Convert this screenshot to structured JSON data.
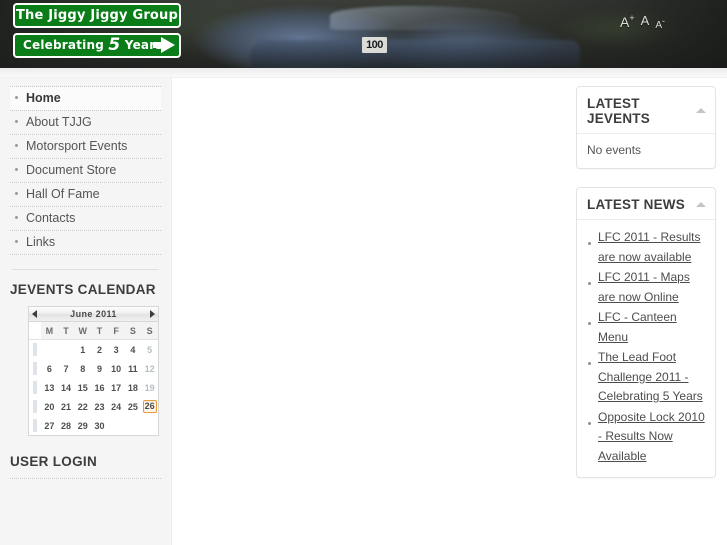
{
  "site": {
    "logo_line1": "The Jiggy Jiggy Group",
    "logo_line2_pre": "Celebrating ",
    "logo_line2_number": "5",
    "logo_line2_post": " Years"
  },
  "header": {
    "car_number": "100",
    "font_size": {
      "increase": "A",
      "increase_sup": "+",
      "reset": "A",
      "decrease": "A",
      "decrease_sup": "-"
    }
  },
  "sidebar_left": {
    "menu": [
      {
        "label": "Home",
        "active": true
      },
      {
        "label": "About TJJG",
        "active": false
      },
      {
        "label": "Motorsport Events",
        "active": false
      },
      {
        "label": "Document Store",
        "active": false
      },
      {
        "label": "Hall Of Fame",
        "active": false
      },
      {
        "label": "Contacts",
        "active": false
      },
      {
        "label": "Links",
        "active": false
      }
    ],
    "calendar_module_title": "JEVENTS CALENDAR",
    "user_login_title": "USER LOGIN"
  },
  "calendar": {
    "title": "June 2011",
    "prev_label": "Previous month",
    "next_label": "Next month",
    "weekday_headers": [
      "M",
      "T",
      "W",
      "T",
      "F",
      "S",
      "S"
    ],
    "weeks": [
      [
        "",
        "",
        "1",
        "2",
        "3",
        "4",
        "5"
      ],
      [
        "6",
        "7",
        "8",
        "9",
        "10",
        "11",
        "12"
      ],
      [
        "13",
        "14",
        "15",
        "16",
        "17",
        "18",
        "19"
      ],
      [
        "20",
        "21",
        "22",
        "23",
        "24",
        "25",
        "26"
      ],
      [
        "27",
        "28",
        "29",
        "30",
        "",
        "",
        ""
      ]
    ],
    "today": "26",
    "today_border_color": "#e89a3c"
  },
  "sidebar_right": {
    "jevents_panel": {
      "title": "LATEST JEVENTS",
      "body_text": "No events"
    },
    "news_panel": {
      "title": "LATEST NEWS",
      "items": [
        "LFC 2011 - Results are now available",
        "LFC 2011 - Maps are now Online",
        "LFC - Canteen Menu",
        "The Lead Foot Challenge 2011 - Celebrating 5 Years",
        "Opposite Lock 2010 - Results Now Available"
      ]
    }
  },
  "colors": {
    "brand_green": "#0a7d18",
    "header_dark": "#2f3032",
    "sidebar_bg": "#f5f5f5",
    "text": "#444444",
    "link": "#4d4d4d"
  }
}
